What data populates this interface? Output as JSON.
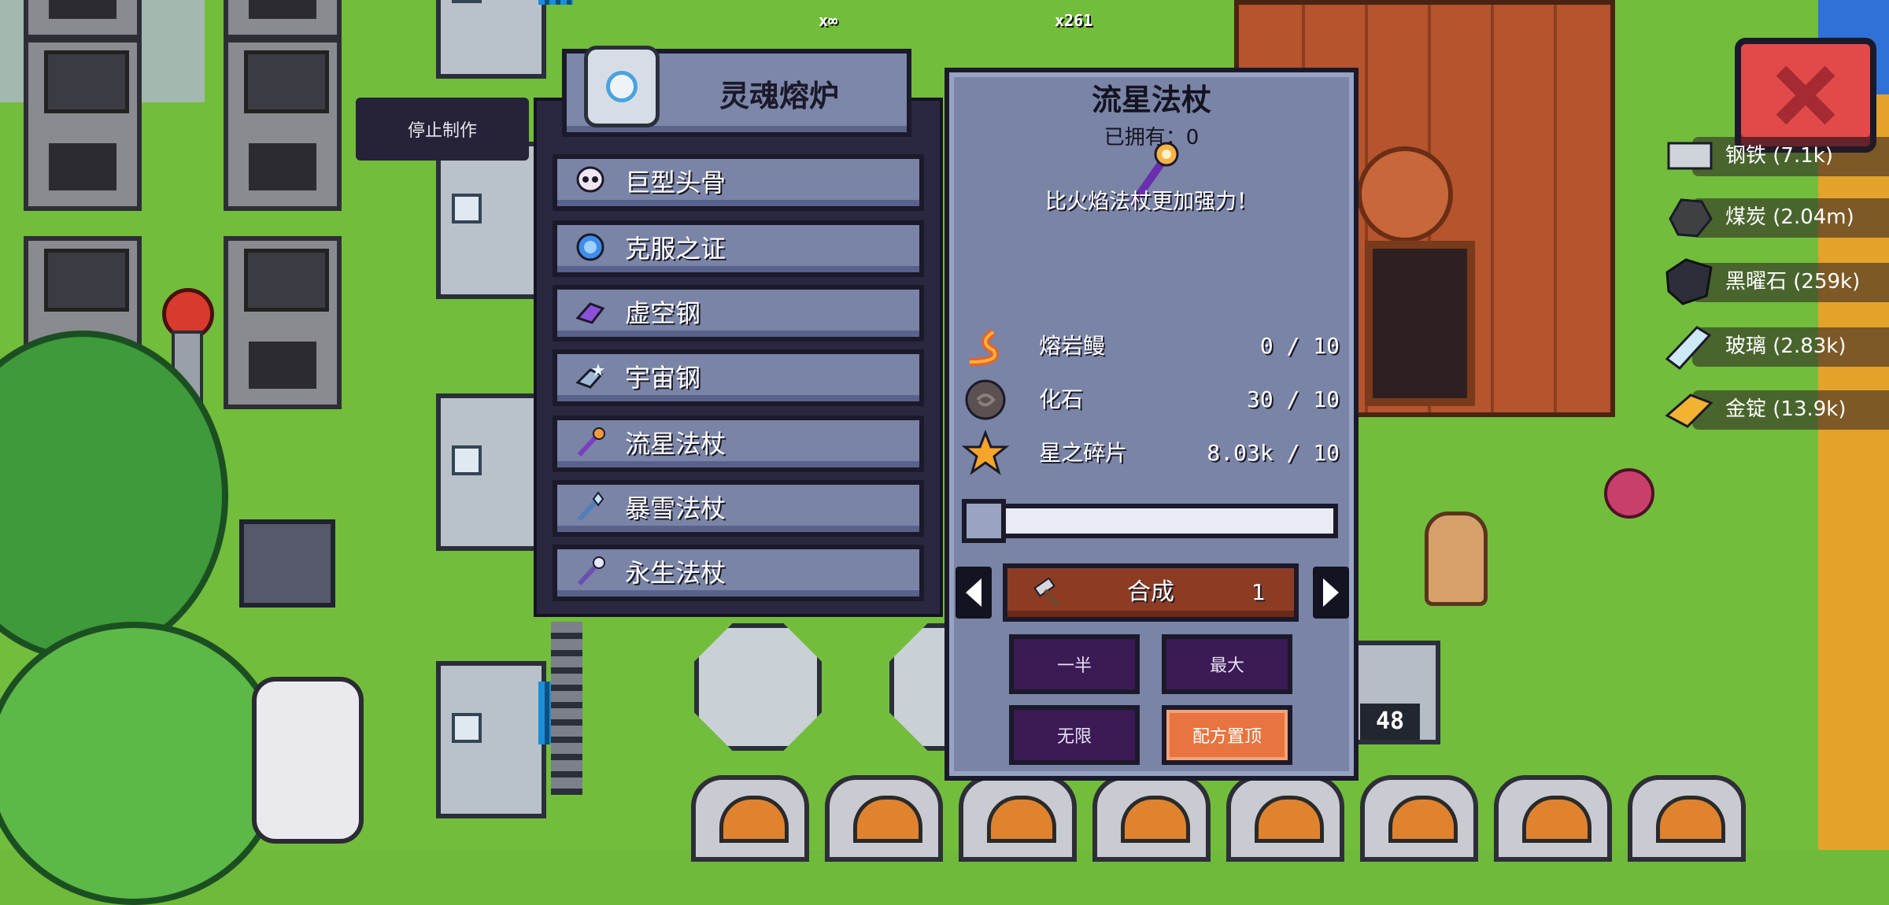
{
  "hud": {
    "stop_crafting_label": "停止制作",
    "top_counts": [
      "x∞",
      "x261"
    ],
    "machine_badge": "48"
  },
  "crafting_station": {
    "title": "灵魂熔炉",
    "recipes": [
      {
        "label": "巨型头骨",
        "icon": "giant-skull-icon"
      },
      {
        "label": "克服之证",
        "icon": "proof-of-conquest-icon"
      },
      {
        "label": "虚空钢",
        "icon": "void-steel-icon"
      },
      {
        "label": "宇宙钢",
        "icon": "cosmic-steel-icon"
      },
      {
        "label": "流星法杖",
        "icon": "meteor-staff-icon"
      },
      {
        "label": "暴雪法杖",
        "icon": "blizzard-staff-icon"
      },
      {
        "label": "永生法杖",
        "icon": "eternal-staff-icon"
      }
    ]
  },
  "detail": {
    "name": "流星法杖",
    "owned": "已拥有：0",
    "description": "比火焰法杖更加强力！",
    "ingredients": [
      {
        "name": "熔岩鳗",
        "count": "0 / 10",
        "icon": "lava-eel-icon"
      },
      {
        "name": "化石",
        "count": "30 / 10",
        "icon": "fossil-icon"
      },
      {
        "name": "星之碎片",
        "count": "8.03k / 10",
        "icon": "star-fragment-icon"
      }
    ],
    "quantity_slider_fraction": 0.0,
    "craft_label": "合成",
    "craft_quantity": "1",
    "half_label": "一半",
    "max_label": "最大",
    "infinite_label": "无限",
    "pin_recipe_label": "配方置顶"
  },
  "resources": [
    {
      "label": "钢铁 (7.1k)",
      "icon": "steel-icon"
    },
    {
      "label": "煤炭 (2.04m)",
      "icon": "coal-icon"
    },
    {
      "label": "黑曜石 (259k)",
      "icon": "obsidian-icon"
    },
    {
      "label": "玻璃 (2.83k)",
      "icon": "glass-icon"
    },
    {
      "label": "金锭 (13.9k)",
      "icon": "gold-ingot-icon"
    }
  ],
  "colors": {
    "panel": "#7a84a6",
    "outline": "#1b1a2a",
    "craft_button": "#8d3c24",
    "option_button": "#3c1a55",
    "pin_button": "#e8743f",
    "close_button": "#e24a4a"
  }
}
